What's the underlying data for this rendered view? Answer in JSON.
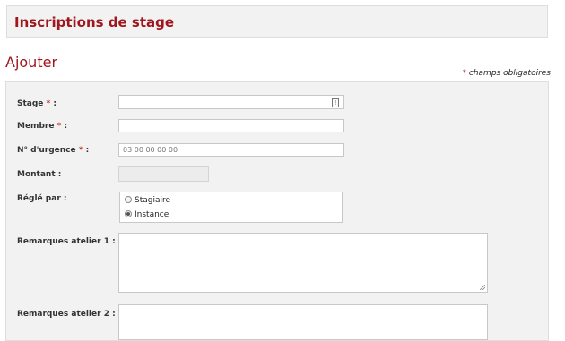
{
  "header": {
    "title": "Inscriptions de stage"
  },
  "section": {
    "title": "Ajouter"
  },
  "required_note": {
    "star": "*",
    "text": "champs obligatoires"
  },
  "form": {
    "stage": {
      "label": "Stage",
      "value": ""
    },
    "membre": {
      "label": "Membre",
      "value": ""
    },
    "urgence": {
      "label": "N° d'urgence",
      "placeholder": "03 00 00 00 00"
    },
    "montant": {
      "label": "Montant :",
      "value": ""
    },
    "regle_par": {
      "label": "Réglé par :",
      "options": [
        {
          "label": "Stagiaire",
          "checked": false
        },
        {
          "label": "Instance",
          "checked": true
        }
      ]
    },
    "remarques1": {
      "label": "Remarques atelier 1 :",
      "value": ""
    },
    "remarques2": {
      "label": "Remarques atelier 2 :",
      "value": ""
    },
    "required_star": "*",
    "colon": ":"
  }
}
